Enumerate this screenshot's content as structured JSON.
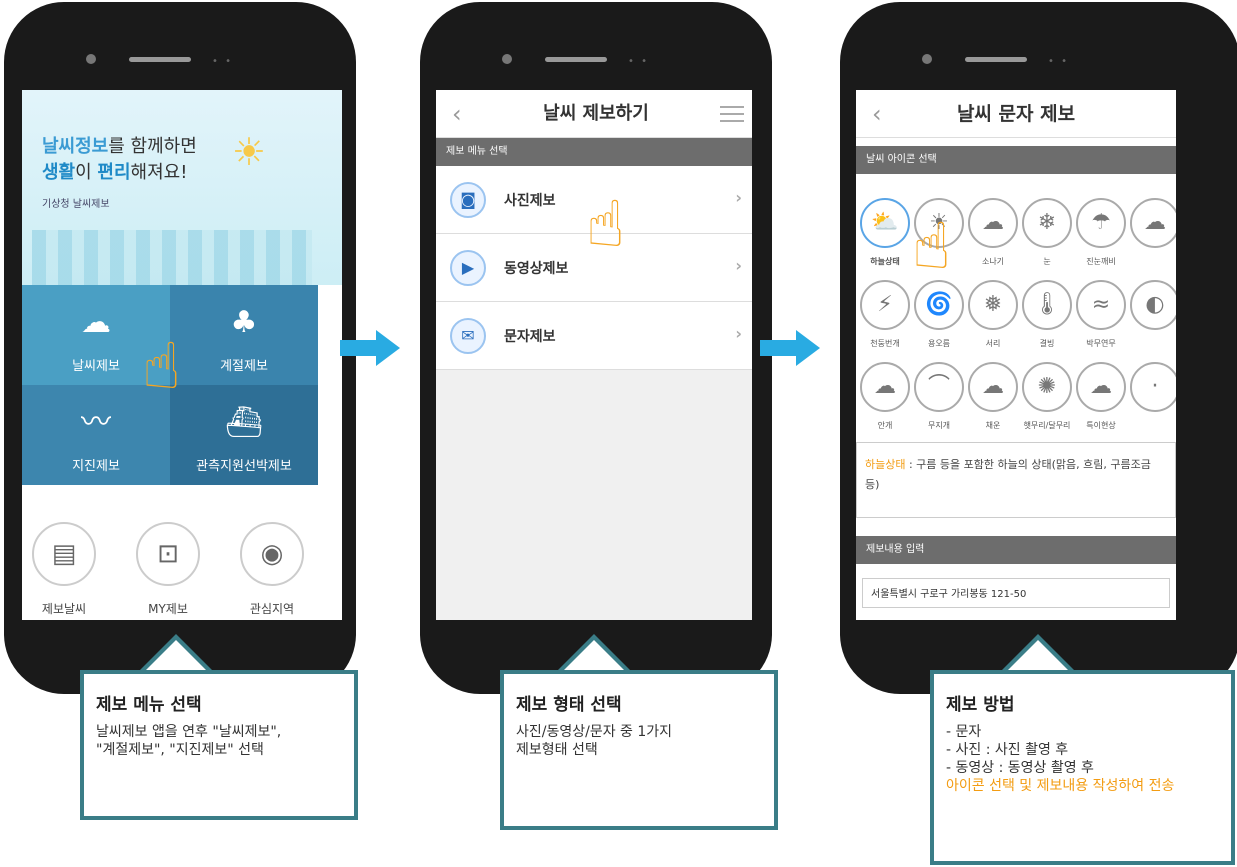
{
  "phone1": {
    "headline_blue": "날씨정보",
    "headline_rest": "를 함께하면",
    "line2_a": "생활",
    "line2_b": "이 ",
    "line2_c": "편리",
    "line2_d": "해져요!",
    "subtitle": "기상청 날씨제보",
    "tiles": [
      {
        "label": "날씨제보",
        "icon": "cloud-sun-icon",
        "color": "#4a9fc4"
      },
      {
        "label": "계절제보",
        "icon": "tree-butterfly-icon",
        "color": "#3a84ad"
      },
      {
        "label": "지진제보",
        "icon": "seismograph-icon",
        "color": "#3d86ae"
      },
      {
        "label": "관측지원선박제보",
        "icon": "ship-icon",
        "color": "#2e6f96"
      }
    ],
    "bottom": [
      {
        "label": "제보날씨",
        "icon": "document-icon"
      },
      {
        "label": "MY제보",
        "icon": "profile-icon"
      },
      {
        "label": "관심지역",
        "icon": "location-pin-icon"
      }
    ]
  },
  "phone2": {
    "title": "날씨 제보하기",
    "section": "제보 메뉴 선택",
    "rows": [
      {
        "label": "사진제보",
        "icon": "camera-icon"
      },
      {
        "label": "동영상제보",
        "icon": "video-icon"
      },
      {
        "label": "문자제보",
        "icon": "envelope-icon"
      }
    ]
  },
  "phone3": {
    "title": "날씨 문자 제보",
    "section_icons": "날씨 아이콘 선택",
    "icons_row1": [
      "하늘상태",
      "",
      "소나기",
      "눈",
      "진눈깨비"
    ],
    "icons_row2": [
      "천둥번개",
      "용오름",
      "서리",
      "결빙",
      "박무연무"
    ],
    "icons_row3": [
      "안개",
      "무지개",
      "채운",
      "햇무리/달무리",
      "특이현상"
    ],
    "desc_highlight": "하늘상태",
    "desc_text": " : 구름 등을 포함한 하늘의 상태(맑음, 흐림, 구름조금 등)",
    "section_input": "제보내용 입력",
    "address": "서울특별시 구로구 가리봉동 121-50"
  },
  "callout1": {
    "title": "제보 메뉴 선택",
    "body": "날씨제보 앱을 연후 \"날씨제보\",\n\"계절제보\", \"지진제보\" 선택"
  },
  "callout2": {
    "title": "제보 형태 선택",
    "body": "사진/동영상/문자 중 1가지\n제보형태 선택"
  },
  "callout3": {
    "title": "제보 방법",
    "lines": [
      "- 문자",
      "- 사진 : 사진 촬영 후",
      "- 동영상 : 동영상 촬영 후"
    ],
    "highlight": "아이콘 선택 및 제보내용 작성하여 전송"
  },
  "colors": {
    "accent_arrow": "#29abe2",
    "callout_border": "#3a7d87",
    "highlight": "#f39c12"
  }
}
